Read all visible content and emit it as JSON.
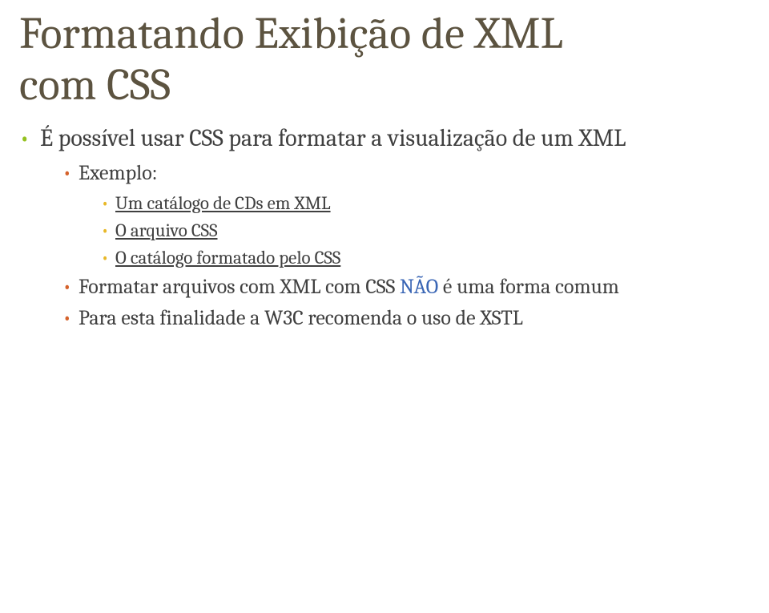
{
  "title_line1": "Formatando Exibição de XML",
  "title_line2": "com CSS",
  "bullet1": {
    "text": "É possível usar CSS para formatar a visualização de um XML",
    "sub": {
      "label": "Exemplo:",
      "items": [
        "Um catálogo de CDs em XML",
        "O arquivo CSS",
        "O catálogo formatado pelo CSS"
      ]
    }
  },
  "bullet2": {
    "prefix": "Formatar arquivos com XML com CSS ",
    "emph": "NÃO",
    "suffix": " é uma forma comum"
  },
  "bullet3": "Para esta finalidade a W3C recomenda o uso de XSTL"
}
